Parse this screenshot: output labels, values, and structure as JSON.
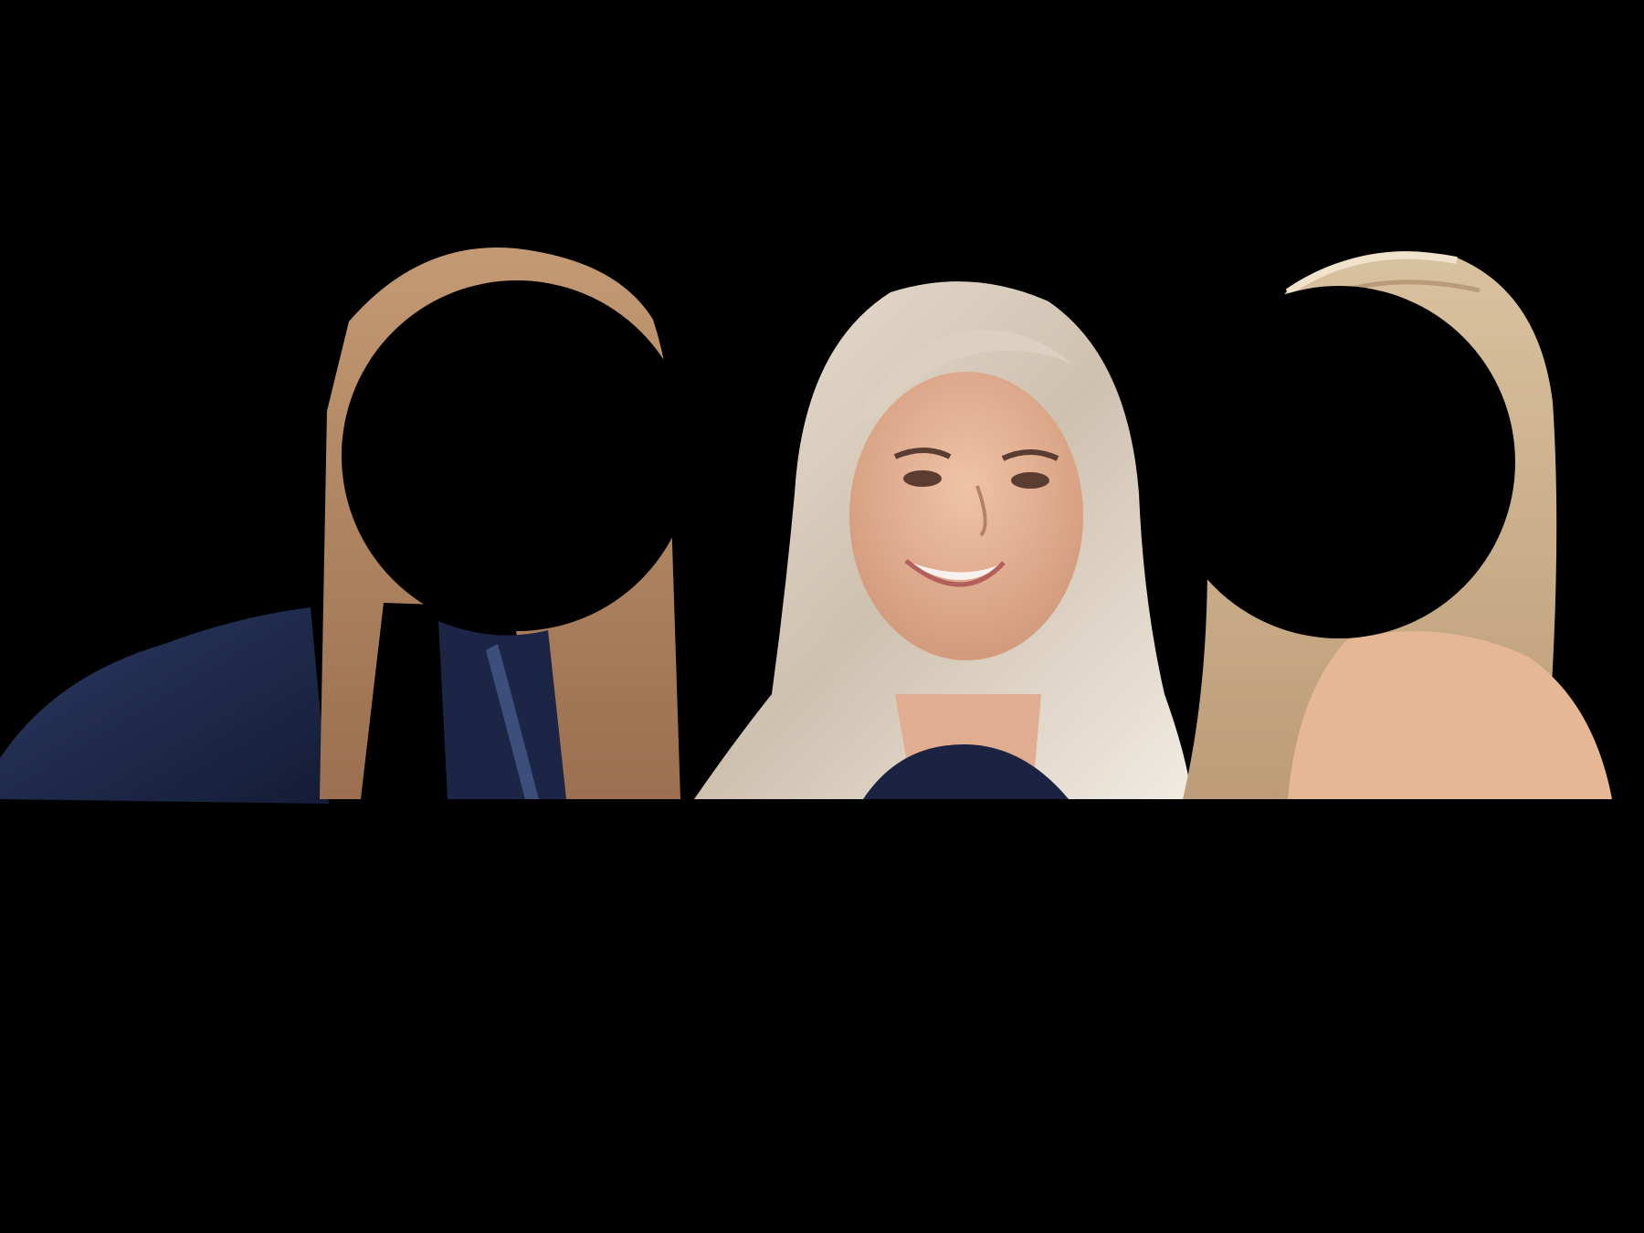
{
  "image": {
    "background_color": "#000000",
    "subjects": [
      {
        "role": "left-person",
        "face_redacted": true,
        "hair_color": "#b98a63",
        "clothing_color": "#1e2a4d"
      },
      {
        "role": "center-person",
        "face_redacted": false,
        "hair_color": "#d8cdbf",
        "skin_color": "#e2b497",
        "clothing_color": "#1b2240"
      },
      {
        "role": "right-person",
        "face_redacted": true,
        "hair_color": "#d2b792",
        "skin_color": "#e7b996"
      }
    ],
    "redaction_shape": "circle",
    "redaction_color": "#000000"
  }
}
